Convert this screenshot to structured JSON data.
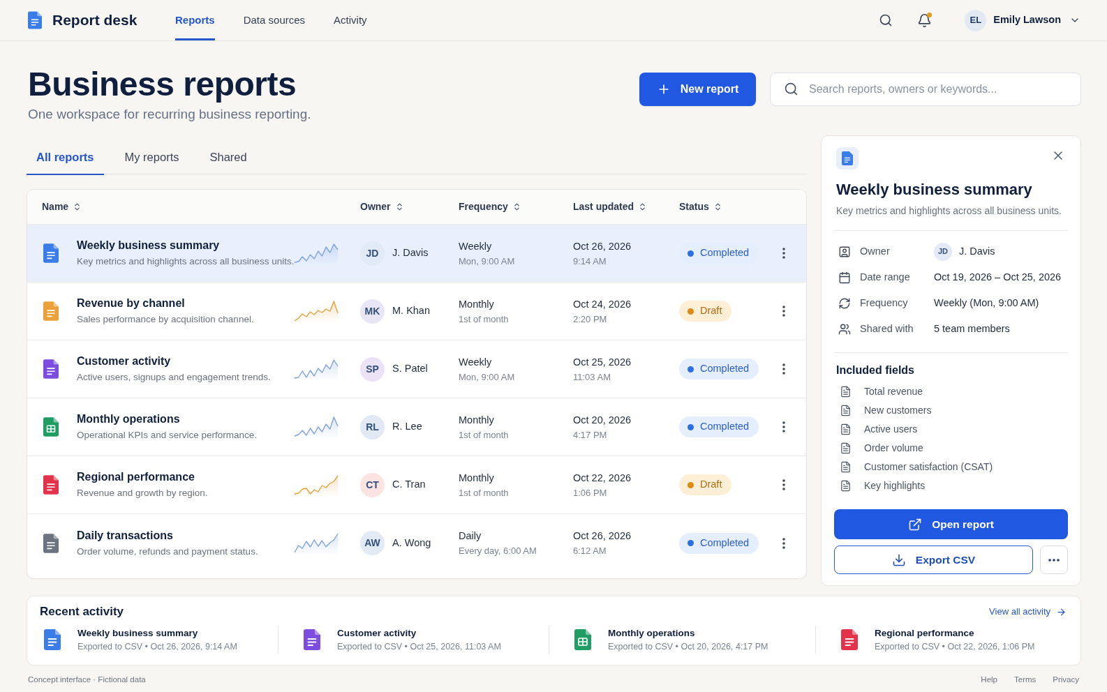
{
  "app": {
    "name": "Report desk"
  },
  "nav": [
    {
      "label": "Reports",
      "selected": true
    },
    {
      "label": "Data sources",
      "selected": false
    },
    {
      "label": "Activity",
      "selected": false
    }
  ],
  "notifications": {
    "unread": true
  },
  "user": {
    "initials": "EL",
    "name": "Emily Lawson"
  },
  "header": {
    "title": "Business reports",
    "subtitle": "One workspace for recurring business reporting.",
    "new_button": "New report",
    "search": {
      "placeholder": "Search reports, owners or keywords..."
    }
  },
  "tabs": [
    {
      "label": "All reports",
      "selected": true
    },
    {
      "label": "My reports",
      "selected": false
    },
    {
      "label": "Shared",
      "selected": false
    }
  ],
  "table": {
    "columns": [
      "Name",
      "Owner",
      "Frequency",
      "Last updated",
      "Status"
    ],
    "rows": [
      {
        "selected": true,
        "kind": "doc",
        "color": "#3b7de8",
        "name": "Weekly business summary",
        "description": "Key metrics and highlights across all business units.",
        "owner": {
          "initials": "JD",
          "name": "J. Davis",
          "color": "#e2eaf6"
        },
        "frequency": "Weekly",
        "schedule": "Mon, 9:00 AM",
        "date": "Oct 26, 2026",
        "time": "9:14 AM",
        "status": {
          "label": "Completed",
          "kind": "completed"
        }
      },
      {
        "selected": false,
        "kind": "doc",
        "color": "#eba03a",
        "name": "Revenue by channel",
        "description": "Sales performance by acquisition channel.",
        "owner": {
          "initials": "MK",
          "name": "M. Khan",
          "color": "#e8e6f4"
        },
        "frequency": "Monthly",
        "schedule": "1st of month",
        "date": "Oct 24, 2026",
        "time": "2:20 PM",
        "status": {
          "label": "Draft",
          "kind": "draft"
        }
      },
      {
        "selected": false,
        "kind": "doc",
        "color": "#7c4ddf",
        "name": "Customer activity",
        "description": "Active users, signups and engagement trends.",
        "owner": {
          "initials": "SP",
          "name": "S. Patel",
          "color": "#ece2f6"
        },
        "frequency": "Weekly",
        "schedule": "Mon, 9:00 AM",
        "date": "Oct 25, 2026",
        "time": "11:03 AM",
        "status": {
          "label": "Completed",
          "kind": "completed"
        }
      },
      {
        "selected": false,
        "kind": "sheet",
        "color": "#1f9d63",
        "name": "Monthly operations",
        "description": "Operational KPIs and service performance.",
        "owner": {
          "initials": "RL",
          "name": "R. Lee",
          "color": "#e1e9f5"
        },
        "frequency": "Monthly",
        "schedule": "1st of month",
        "date": "Oct 20, 2026",
        "time": "4:17 PM",
        "status": {
          "label": "Completed",
          "kind": "completed"
        }
      },
      {
        "selected": false,
        "kind": "doc",
        "color": "#e2334a",
        "name": "Regional performance",
        "description": "Revenue and growth by region.",
        "owner": {
          "initials": "CT",
          "name": "C. Tran",
          "color": "#fae3e0"
        },
        "frequency": "Monthly",
        "schedule": "1st of month",
        "date": "Oct 22, 2026",
        "time": "1:06 PM",
        "status": {
          "label": "Draft",
          "kind": "draft"
        }
      },
      {
        "selected": false,
        "kind": "doc",
        "color": "#6b7280",
        "name": "Daily transactions",
        "description": "Order volume, refunds and payment status.",
        "owner": {
          "initials": "AW",
          "name": "A. Wong",
          "color": "#e2eaf4"
        },
        "frequency": "Daily",
        "schedule": "Every day, 6:00 AM",
        "date": "Oct 26, 2026",
        "time": "6:12 AM",
        "status": {
          "label": "Completed",
          "kind": "completed"
        }
      }
    ]
  },
  "panel": {
    "title": "Weekly business summary",
    "description": "Key metrics and highlights across all business units.",
    "details": [
      {
        "kind": "owner",
        "label": "Owner",
        "initials": "JD",
        "value": "J. Davis"
      },
      {
        "kind": "dates",
        "label": "Date range",
        "value": "Oct 19, 2026 – Oct 25, 2026"
      },
      {
        "kind": "schedule",
        "label": "Frequency",
        "value": "Weekly (Mon, 9:00 AM)"
      },
      {
        "kind": "sharing",
        "label": "Shared with",
        "value": "5 team members"
      }
    ],
    "fields_title": "Included fields",
    "fields": [
      "Total revenue",
      "New customers",
      "Active users",
      "Order volume",
      "Customer satisfaction (CSAT)",
      "Key highlights"
    ],
    "open_button": "Open report",
    "export_button": "Export CSV"
  },
  "recent": {
    "title": "Recent activity",
    "link": "View all activity",
    "items": [
      {
        "kind": "doc",
        "color": "#3b7de8",
        "name": "Weekly business summary",
        "detail": "Exported to CSV • Oct 26, 2026, 9:14 AM"
      },
      {
        "kind": "doc",
        "color": "#7c4ddf",
        "name": "Customer activity",
        "detail": "Exported to CSV • Oct 25, 2026, 11:03 AM"
      },
      {
        "kind": "sheet",
        "color": "#1f9d63",
        "name": "Monthly operations",
        "detail": "Exported to CSV • Oct 20, 2026, 4:17 PM"
      },
      {
        "kind": "doc",
        "color": "#e2334a",
        "name": "Regional performance",
        "detail": "Exported to CSV • Oct 22, 2026, 1:06 PM"
      }
    ]
  },
  "footer": {
    "note": "Concept interface · Fictional data",
    "links": [
      "Help",
      "Terms",
      "Privacy"
    ]
  }
}
